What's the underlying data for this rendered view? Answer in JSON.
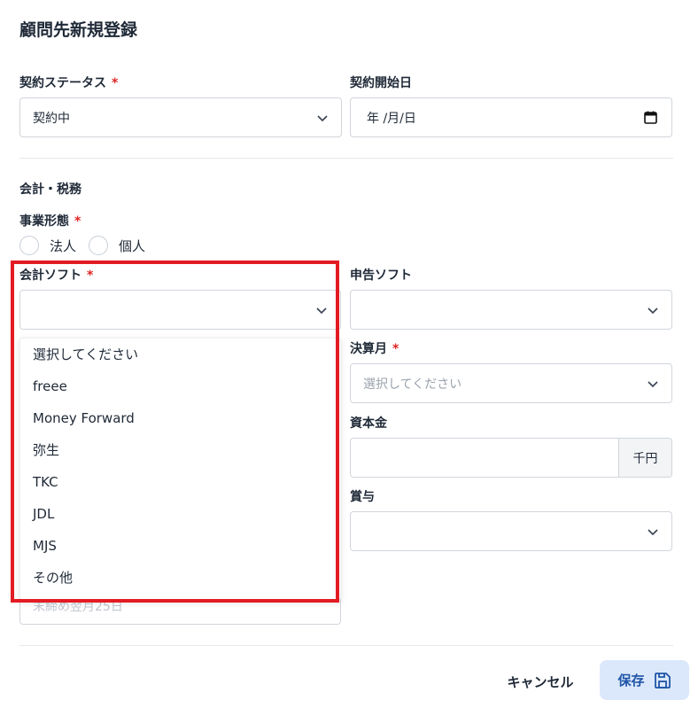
{
  "dialog": {
    "title": "顧問先新規登録"
  },
  "contract": {
    "status_label": "契約ステータス",
    "status_value": "契約中",
    "start_label": "契約開始日",
    "start_value": "年 /月/日"
  },
  "required_mark": "*",
  "accounting": {
    "section_title": "会計・税務",
    "business_type_label": "事業形態",
    "business_type_options": [
      "法人",
      "個人"
    ],
    "software_label": "会計ソフト",
    "software_value": "",
    "software_options": [
      "選択してください",
      "freee",
      "Money Forward",
      "弥生",
      "TKC",
      "JDL",
      "MJS",
      "その他"
    ],
    "tax_software_label": "申告ソフト",
    "tax_software_value": "",
    "fiscal_month_label": "決算月",
    "fiscal_month_placeholder": "選択してください",
    "capital_label": "資本金",
    "capital_value": "",
    "capital_unit": "千円",
    "bonus_label": "賞与",
    "bonus_value": "",
    "hidden_field_placeholder": "末締め翌月25日"
  },
  "footer": {
    "cancel_label": "キャンセル",
    "save_label": "保存"
  },
  "colors": {
    "required": "#e02424",
    "highlight": "#e31b23",
    "save_bg": "#dbe8fb",
    "save_text": "#1f55a8"
  }
}
